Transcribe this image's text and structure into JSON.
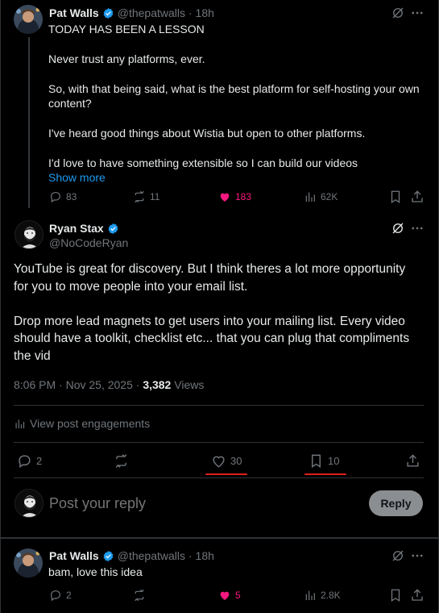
{
  "tweet1": {
    "name": "Pat Walls",
    "handle": "@thepatwalls",
    "time": "· 18h",
    "lines": [
      "TODAY HAS BEEN A LESSON",
      "Never trust any platforms, ever.",
      "So, with that being said, what is the best platform for self-hosting your own",
      "content?",
      "I've heard good things about Wistia but open to other platforms.",
      "I'd love to have something extensible so I can build our videos"
    ],
    "show_more": "Show more",
    "replies": "83",
    "reposts": "11",
    "likes": "183",
    "views": "62K"
  },
  "main": {
    "name": "Ryan Stax",
    "handle": "@NoCodeRyan",
    "lines": [
      "YouTube is great for discovery. But I think theres a lot more opportunity",
      "for you to move people into your email list.",
      "Drop more lead magnets to get users into your mailing list. Every video",
      "should have a toolkit, checklist etc... that you can plug that compliments",
      "the vid"
    ],
    "timestamp": "8:06 PM · Nov 25, 2025 · ",
    "view_count": "3,382",
    "views_label": " Views",
    "engagements": "View post engagements",
    "replies": "2",
    "likes": "30",
    "bookmarks": "10"
  },
  "composer": {
    "placeholder": "Post your reply",
    "reply_label": "Reply"
  },
  "tweet2": {
    "name": "Pat Walls",
    "handle": "@thepatwalls",
    "time": "· 18h",
    "text": "bam, love this idea",
    "replies": "2",
    "likes": "5",
    "views": "2.8K"
  },
  "colors": {
    "background": "#000000",
    "text": "#e7e9ea",
    "muted": "#71767b",
    "like_pink": "#f91880",
    "verified_blue": "#1d9bf0",
    "annotation_red": "#e0201b",
    "reply_button": "#8b8e91"
  }
}
